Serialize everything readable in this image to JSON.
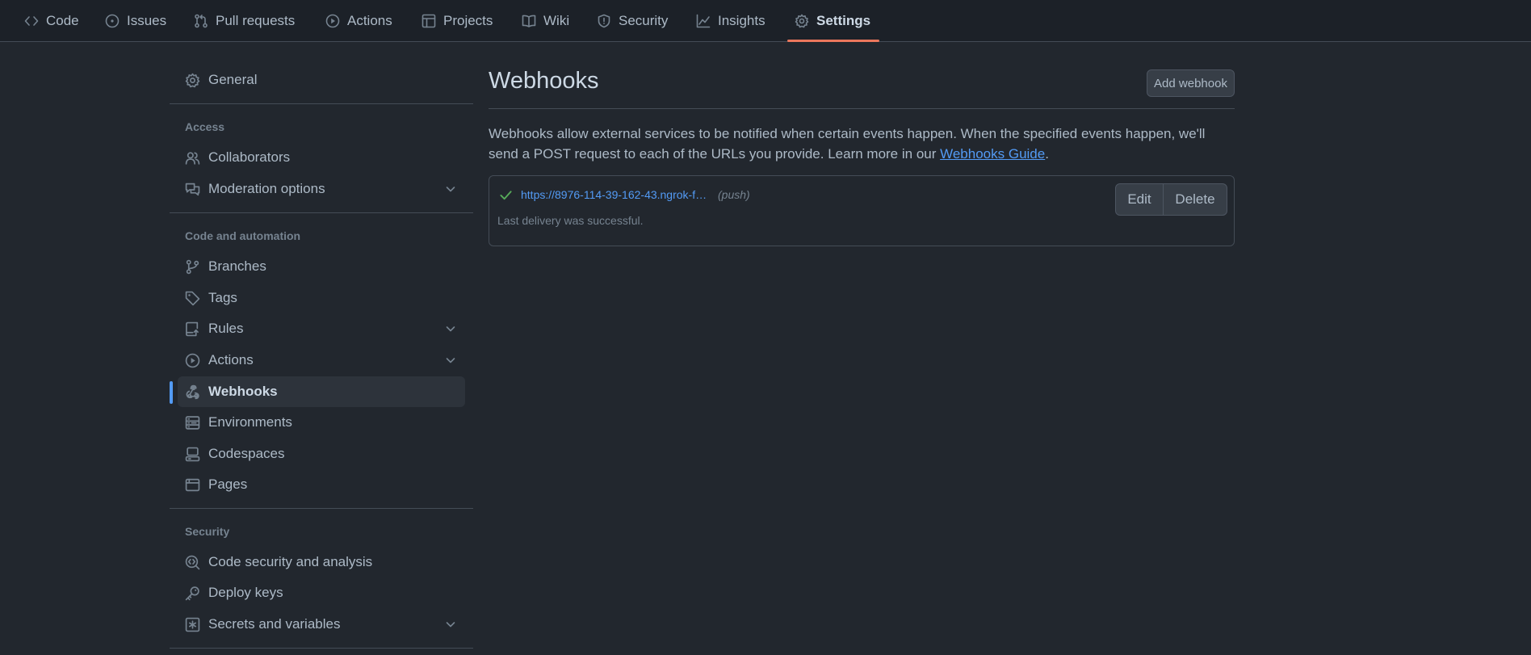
{
  "repo_nav": {
    "tabs": [
      {
        "label": "Code",
        "icon": "code-icon"
      },
      {
        "label": "Issues",
        "icon": "issue-icon"
      },
      {
        "label": "Pull requests",
        "icon": "pull-request-icon"
      },
      {
        "label": "Actions",
        "icon": "play-icon"
      },
      {
        "label": "Projects",
        "icon": "table-icon"
      },
      {
        "label": "Wiki",
        "icon": "book-icon"
      },
      {
        "label": "Security",
        "icon": "shield-icon"
      },
      {
        "label": "Insights",
        "icon": "graph-icon"
      },
      {
        "label": "Settings",
        "icon": "gear-icon",
        "selected": true
      }
    ]
  },
  "sidebar": {
    "general": "General",
    "sections": [
      {
        "heading": "Access",
        "items": [
          "Collaborators",
          "Moderation options"
        ]
      },
      {
        "heading": "Code and automation",
        "items": [
          "Branches",
          "Tags",
          "Rules",
          "Actions",
          "Webhooks",
          "Environments",
          "Codespaces",
          "Pages"
        ]
      },
      {
        "heading": "Security",
        "items": [
          "Code security and analysis",
          "Deploy keys",
          "Secrets and variables"
        ]
      }
    ],
    "active_item": "Webhooks"
  },
  "main": {
    "title": "Webhooks",
    "add_button": "Add webhook",
    "description": "Webhooks allow external services to be notified when certain events happen. When the specified events happen, we'll send a POST request to each of the URLs you provide. Learn more in our ",
    "guide_link": "Webhooks Guide",
    "description_end": ".",
    "webhooks": [
      {
        "url": "https://8976-114-39-162-43.ngrok-f…",
        "events": "(push)",
        "status": "Last delivery was successful.",
        "edit_label": "Edit",
        "delete_label": "Delete"
      }
    ]
  },
  "colors": {
    "background": "#22272e",
    "accent_link": "#539bf5",
    "selected_tab_underline": "#ec775c",
    "success": "#57ab5a"
  }
}
